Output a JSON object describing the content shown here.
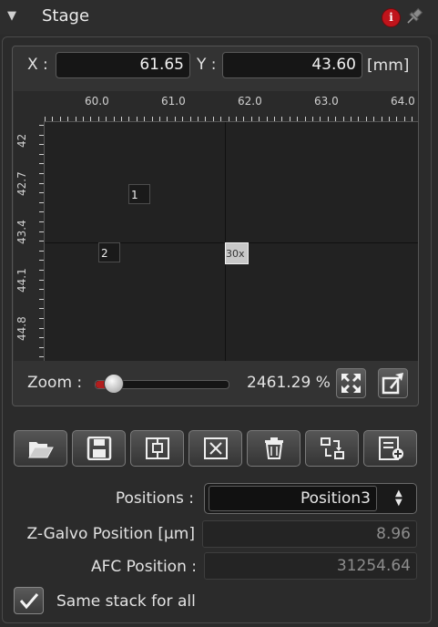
{
  "header": {
    "title": "Stage",
    "collapse_icon": "triangle-down-icon",
    "info_glyph": "i"
  },
  "coords": {
    "x_label": "X :",
    "x_value": "61.65",
    "y_label": "Y :",
    "y_value": "43.60",
    "unit": "[mm]"
  },
  "ruler": {
    "h_ticks": [
      "60.0",
      "61.0",
      "62.0",
      "63.0",
      "64.0"
    ],
    "v_ticks": [
      "42",
      "42.7",
      "43.4",
      "44.1",
      "44.8"
    ]
  },
  "markers": [
    {
      "label": "1",
      "x": 60.4,
      "y": 42.9
    },
    {
      "label": "2",
      "x": 60.0,
      "y": 43.7
    }
  ],
  "current_position": {
    "label": "30x",
    "x": 61.65,
    "y": 43.6
  },
  "zoom": {
    "label": "Zoom :",
    "value_text": "2461.29 %",
    "slider_fraction": 0.1
  },
  "toolbar": [
    "open-folder-icon",
    "save-icon",
    "set-position-icon",
    "clear-position-icon",
    "trash-icon",
    "reorder-icon",
    "add-list-icon"
  ],
  "form": {
    "positions_label": "Positions :",
    "positions_value": "Position3",
    "zgalvo_label": "Z-Galvo Position [μm]",
    "zgalvo_value": "8.96",
    "afc_label": "AFC Position :",
    "afc_value": "31254.64",
    "same_stack_label": "Same stack for all",
    "same_stack_checked": true
  }
}
